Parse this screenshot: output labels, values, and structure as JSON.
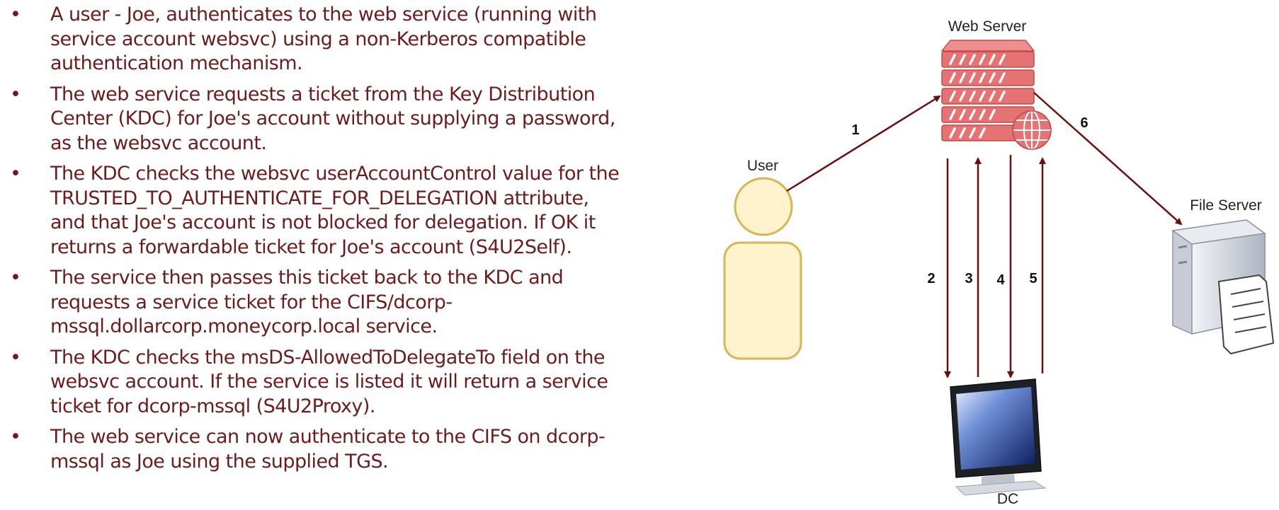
{
  "bullets": [
    "A user - Joe,  authenticates to the web service (running with\nservice account websvc) using a non-Kerberos compatible\nauthentication mechanism.",
    "The web service requests a ticket from the Key Distribution\nCenter (KDC) for Joe's account without supplying a password,\nas the websvc account.",
    "The KDC checks the websvc userAccountControl value for the\nTRUSTED_TO_AUTHENTICATE_FOR_DELEGATION attribute,\nand that Joe's account is not blocked for delegation. If OK it\nreturns a forwardable ticket for Joe's account (S4U2Self).",
    "The service then passes this ticket back to the KDC and\nrequests a service ticket for the CIFS/dcorp-\nmssql.dollarcorp.moneycorp.local service.",
    "The KDC checks the msDS-AllowedToDelegateTo field on the\nwebsvc account. If the service is listed it will return a service\nticket for dcorp-mssql (S4U2Proxy).",
    "The web service can now authenticate to the CIFS on dcorp-\nmssql as Joe using the supplied TGS."
  ],
  "bullet_symbol": "•",
  "diagram": {
    "nodes": {
      "web_server": "Web Server",
      "user": "User",
      "file_server": "File Server",
      "dc": "DC"
    },
    "steps": [
      "1",
      "2",
      "3",
      "4",
      "5",
      "6"
    ]
  },
  "colors": {
    "text": "#6b1d1d",
    "arrow": "#6b0f0f",
    "server_red": "#e57373",
    "user_fill": "#fff2cc",
    "user_stroke": "#d6b656"
  }
}
